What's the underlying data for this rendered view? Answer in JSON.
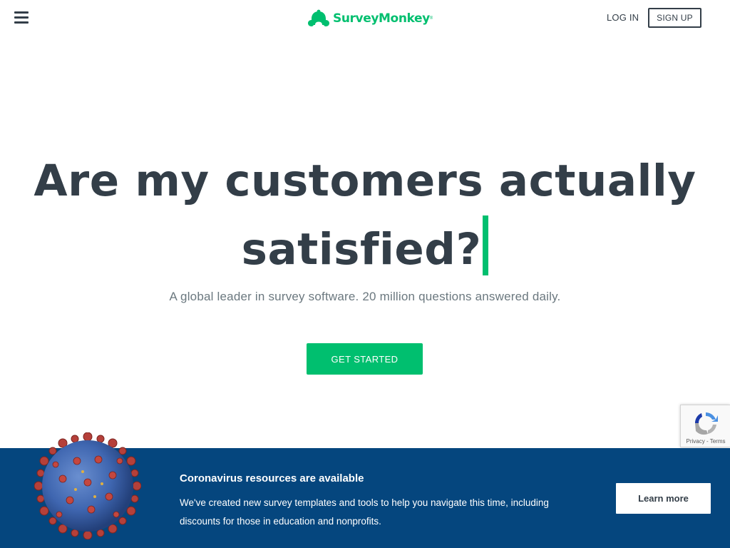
{
  "header": {
    "menu_icon": "hamburger-menu-icon",
    "logo_text": "SurveyMonkey",
    "logo_reg": "®",
    "logo_icon": "monkey-logo-icon",
    "login_label": "LOG IN",
    "signup_label": "SIGN UP"
  },
  "hero": {
    "title_line1": "Are my customers actually",
    "title_line2": "satisfied?",
    "subtitle": "A global leader in survey software. 20 million questions answered daily.",
    "cta_label": "GET STARTED"
  },
  "recaptcha": {
    "icon": "recaptcha-icon",
    "privacy_label": "Privacy",
    "separator": " - ",
    "terms_label": "Terms"
  },
  "banner": {
    "image_icon": "coronavirus-image",
    "title": "Coronavirus resources are available",
    "text": "We've created new survey templates and tools to help you navigate this time, including discounts for those in education and nonprofits.",
    "button_label": "Learn more"
  },
  "colors": {
    "brand_green": "#00bf6f",
    "text_dark": "#333e48",
    "banner_blue": "#05467e"
  }
}
